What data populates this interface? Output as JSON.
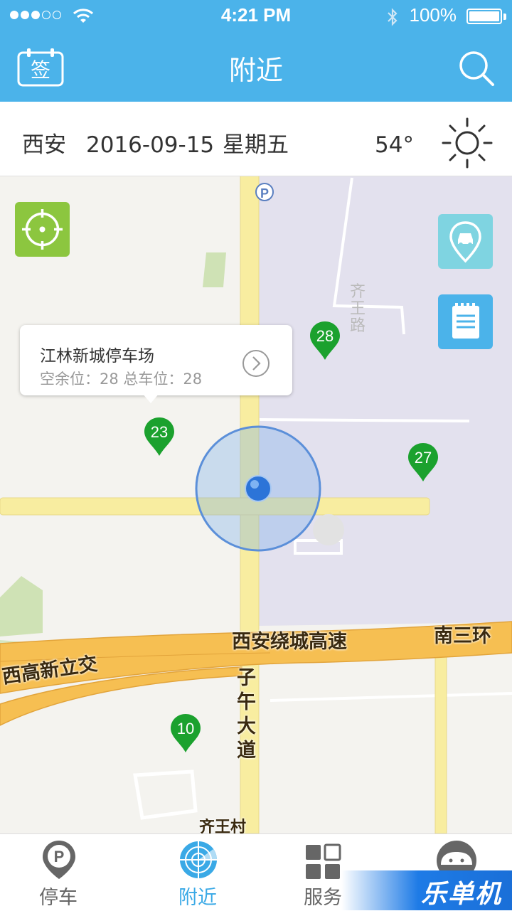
{
  "status_bar": {
    "time": "4:21 PM",
    "battery": "100%"
  },
  "header": {
    "title": "附近",
    "sign_in_icon_text": "签"
  },
  "info_bar": {
    "city": "西安",
    "date": "2016-09-15",
    "weekday": "星期五",
    "temperature": "54°"
  },
  "map": {
    "road_labels": {
      "qiwang_road": "齐王路",
      "ring_expressway": "西安绕城高速",
      "south_third_ring": "南三环",
      "west_gaoxin": "西高新立交",
      "ziwu_avenue": "子午大道",
      "qiwang_village": "齐王村"
    },
    "parking_pins": [
      {
        "count": "28"
      },
      {
        "count": "23"
      },
      {
        "count": "27"
      },
      {
        "count": "10"
      }
    ],
    "callout": {
      "name": "江林新城停车场",
      "detail": "空余位：28 总车位：28"
    }
  },
  "tabs": [
    {
      "label": "停车",
      "active": false
    },
    {
      "label": "附近",
      "active": true
    },
    {
      "label": "服务",
      "active": false
    }
  ],
  "watermark": "乐单机",
  "colors": {
    "header_blue": "#4bb3ea",
    "pin_green": "#1ba12e",
    "locate_green": "#8cc63f",
    "tab_active": "#3aa9e6",
    "tab_inactive": "#666666"
  }
}
